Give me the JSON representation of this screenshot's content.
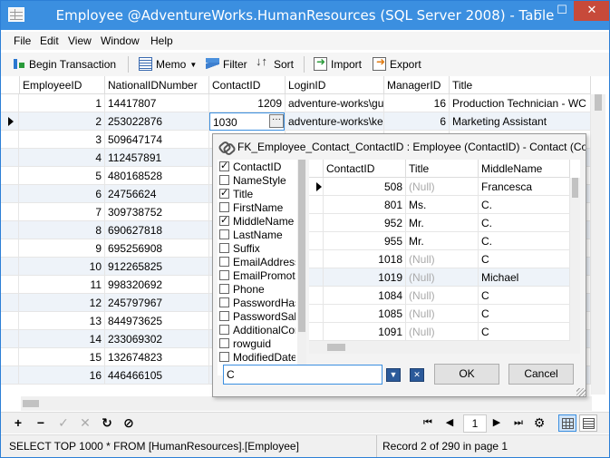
{
  "window": {
    "title": "Employee @AdventureWorks.HumanResources (SQL Server 2008) - Table",
    "controls": {
      "minimize": "–",
      "maximize": "☐",
      "close": "✕"
    }
  },
  "menu": [
    "File",
    "Edit",
    "View",
    "Window",
    "Help"
  ],
  "toolbar": {
    "begin_transaction": "Begin Transaction",
    "memo": "Memo",
    "filter": "Filter",
    "sort": "Sort",
    "import": "Import",
    "export": "Export"
  },
  "grid": {
    "columns": [
      "EmployeeID",
      "NationalIDNumber",
      "ContactID",
      "LoginID",
      "ManagerID",
      "Title"
    ],
    "rows": [
      {
        "id": "1",
        "nid": "14417807",
        "cid": "1209",
        "login": "adventure-works\\gu",
        "mgr": "16",
        "title": "Production Technician - WC"
      },
      {
        "id": "2",
        "nid": "253022876",
        "cid": "1030",
        "login": "adventure-works\\ke",
        "mgr": "6",
        "title": "Marketing Assistant"
      },
      {
        "id": "3",
        "nid": "509647174",
        "cid": "",
        "login": "",
        "mgr": "",
        "title": ""
      },
      {
        "id": "4",
        "nid": "112457891",
        "cid": "",
        "login": "",
        "mgr": "",
        "title": ""
      },
      {
        "id": "5",
        "nid": "480168528",
        "cid": "",
        "login": "",
        "mgr": "",
        "title": ""
      },
      {
        "id": "6",
        "nid": "24756624",
        "cid": "",
        "login": "",
        "mgr": "",
        "title": ""
      },
      {
        "id": "7",
        "nid": "309738752",
        "cid": "",
        "login": "",
        "mgr": "",
        "title": ""
      },
      {
        "id": "8",
        "nid": "690627818",
        "cid": "",
        "login": "",
        "mgr": "",
        "title": ""
      },
      {
        "id": "9",
        "nid": "695256908",
        "cid": "",
        "login": "",
        "mgr": "",
        "title": ""
      },
      {
        "id": "10",
        "nid": "912265825",
        "cid": "",
        "login": "",
        "mgr": "",
        "title": ""
      },
      {
        "id": "11",
        "nid": "998320692",
        "cid": "",
        "login": "",
        "mgr": "",
        "title": ""
      },
      {
        "id": "12",
        "nid": "245797967",
        "cid": "",
        "login": "",
        "mgr": "",
        "title": ""
      },
      {
        "id": "13",
        "nid": "844973625",
        "cid": "",
        "login": "",
        "mgr": "",
        "title": ""
      },
      {
        "id": "14",
        "nid": "233069302",
        "cid": "",
        "login": "",
        "mgr": "",
        "title": ""
      },
      {
        "id": "15",
        "nid": "132674823",
        "cid": "",
        "login": "",
        "mgr": "",
        "title": ""
      },
      {
        "id": "16",
        "nid": "446466105",
        "cid": "",
        "login": "",
        "mgr": "",
        "title": ""
      }
    ],
    "current_row": 1,
    "ellipsis": "···"
  },
  "popup": {
    "title": "FK_Employee_Contact_ContactID : Employee (ContactID) - Contact (ContactID)",
    "fields": [
      {
        "name": "ContactID",
        "checked": true
      },
      {
        "name": "NameStyle",
        "checked": false
      },
      {
        "name": "Title",
        "checked": true
      },
      {
        "name": "FirstName",
        "checked": false
      },
      {
        "name": "MiddleName",
        "checked": true
      },
      {
        "name": "LastName",
        "checked": false
      },
      {
        "name": "Suffix",
        "checked": false
      },
      {
        "name": "EmailAddress",
        "checked": false
      },
      {
        "name": "EmailPromotion",
        "checked": false
      },
      {
        "name": "Phone",
        "checked": false
      },
      {
        "name": "PasswordHash",
        "checked": false
      },
      {
        "name": "PasswordSalt",
        "checked": false
      },
      {
        "name": "AdditionalContactInfo",
        "checked": false
      },
      {
        "name": "rowguid",
        "checked": false
      },
      {
        "name": "ModifiedDate",
        "checked": false
      }
    ],
    "lookup_columns": [
      "ContactID",
      "Title",
      "MiddleName"
    ],
    "lookup_rows": [
      {
        "cid": "508",
        "title": "(Null)",
        "middle": "Francesca",
        "null_title": true
      },
      {
        "cid": "801",
        "title": "Ms.",
        "middle": "C.",
        "null_title": false
      },
      {
        "cid": "952",
        "title": "Mr.",
        "middle": "C.",
        "null_title": false
      },
      {
        "cid": "955",
        "title": "Mr.",
        "middle": "C.",
        "null_title": false
      },
      {
        "cid": "1018",
        "title": "(Null)",
        "middle": "C",
        "null_title": true
      },
      {
        "cid": "1019",
        "title": "(Null)",
        "middle": "Michael",
        "null_title": true
      },
      {
        "cid": "1084",
        "title": "(Null)",
        "middle": "C",
        "null_title": true
      },
      {
        "cid": "1085",
        "title": "(Null)",
        "middle": "C",
        "null_title": true
      },
      {
        "cid": "1091",
        "title": "(Null)",
        "middle": "C",
        "null_title": true
      }
    ],
    "search_value": "C",
    "filter_icon": "funnel-icon",
    "clear_filter_icon": "clear-filter-icon",
    "ok_label": "OK",
    "cancel_label": "Cancel"
  },
  "navbar": {
    "add": "+",
    "delete": "−",
    "apply": "✓",
    "discard": "✕",
    "refresh": "↻",
    "stop": "⊘",
    "first": "⏮",
    "prev": "◀",
    "page": "1",
    "next": "▶",
    "last": "⏭",
    "settings": "⚙"
  },
  "status": {
    "query": "SELECT TOP 1000  * FROM [HumanResources].[Employee]",
    "record_info": "Record 2 of 290 in page 1"
  },
  "colors": {
    "titlebar": "#3b8fe0",
    "accent": "#3b8fe0",
    "null_text": "#aaaaaa"
  }
}
